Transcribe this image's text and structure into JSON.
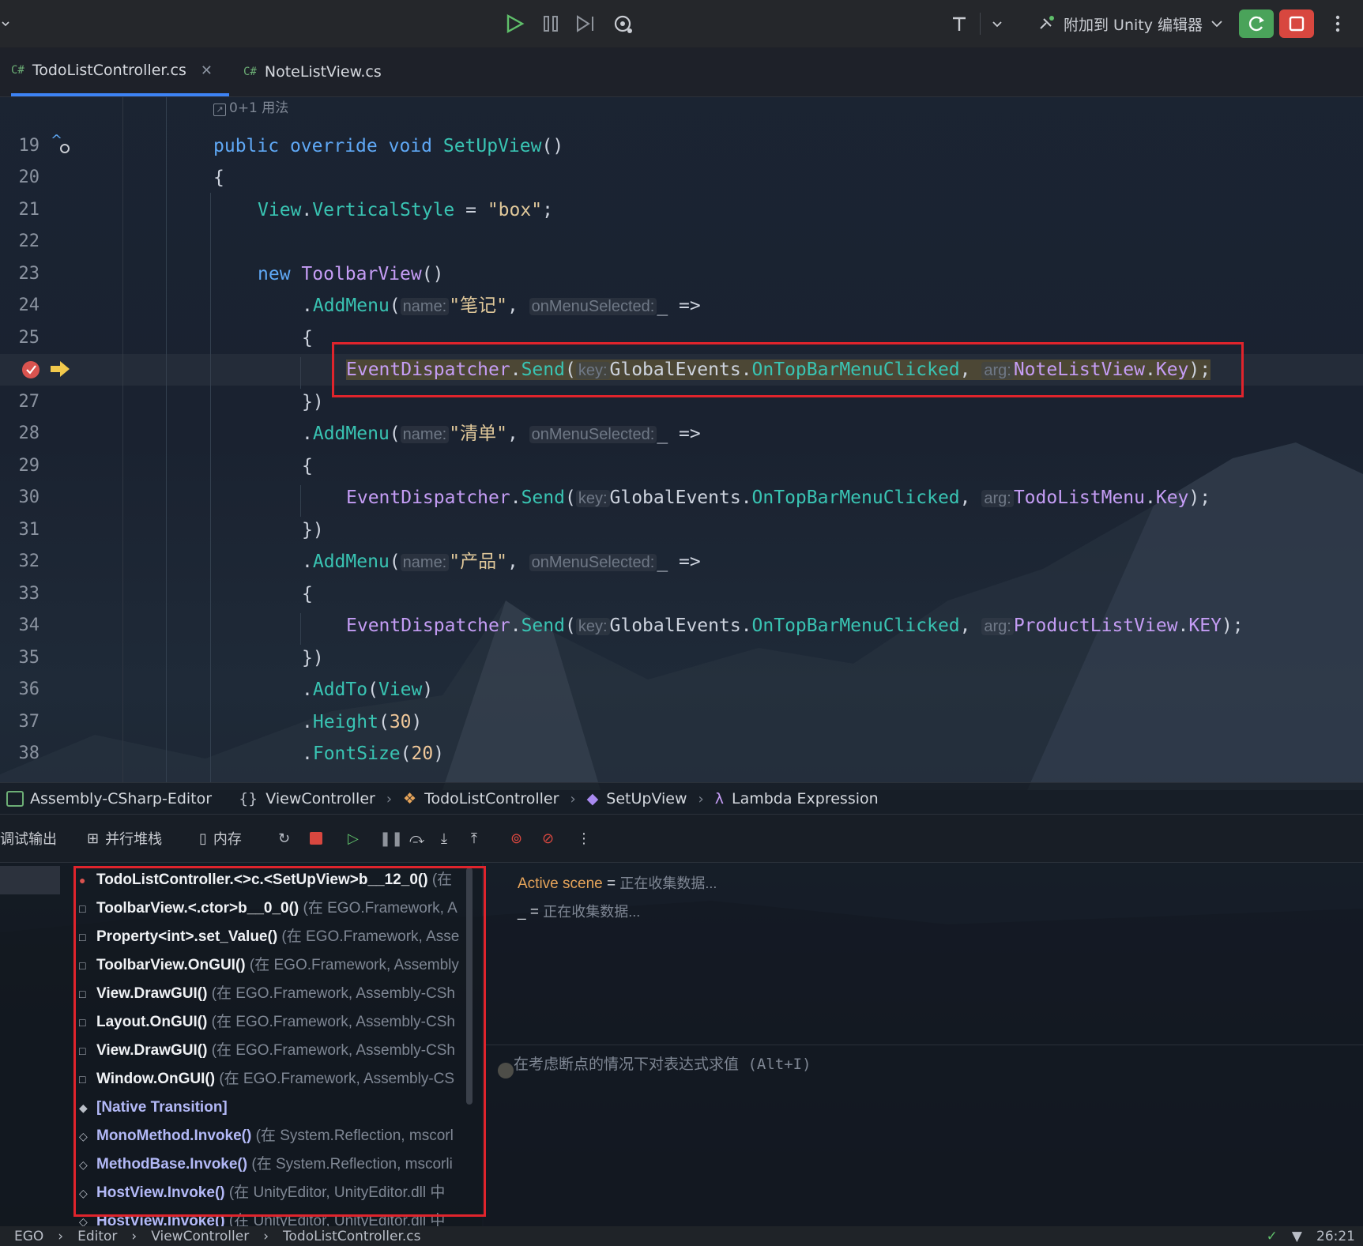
{
  "toolbar": {
    "attach_label": "附加到 Unity 编辑器"
  },
  "tabs": [
    {
      "lang": "C#",
      "label": "TodoListController.cs",
      "active": true
    },
    {
      "lang": "C#",
      "label": "NoteListView.cs",
      "active": false
    }
  ],
  "editor": {
    "usage_hint": "0+1 用法",
    "lines": [
      {
        "n": "19",
        "text": "public override void SetUpView()"
      },
      {
        "n": "20",
        "text": "{"
      },
      {
        "n": "21",
        "text": "View.VerticalStyle = \"box\";"
      },
      {
        "n": "22",
        "text": ""
      },
      {
        "n": "23",
        "text": "new ToolbarView()"
      },
      {
        "n": "24",
        "text": ".AddMenu(name: \"笔记\", onMenuSelected: _ =>"
      },
      {
        "n": "25",
        "text": "{"
      },
      {
        "n": "",
        "text": "EventDispatcher.Send(key: GlobalEvents.OnTopBarMenuClicked, arg: NoteListView.Key);"
      },
      {
        "n": "27",
        "text": "})"
      },
      {
        "n": "28",
        "text": ".AddMenu(name: \"清单\", onMenuSelected: _ =>"
      },
      {
        "n": "29",
        "text": "{"
      },
      {
        "n": "30",
        "text": "EventDispatcher.Send(key: GlobalEvents.OnTopBarMenuClicked, arg: TodoListMenu.Key);"
      },
      {
        "n": "31",
        "text": "})"
      },
      {
        "n": "32",
        "text": ".AddMenu(name: \"产品\", onMenuSelected: _ =>"
      },
      {
        "n": "33",
        "text": "{"
      },
      {
        "n": "34",
        "text": "EventDispatcher.Send(key: GlobalEvents.OnTopBarMenuClicked, arg: ProductListView.KEY);"
      },
      {
        "n": "35",
        "text": "})"
      },
      {
        "n": "36",
        "text": ".AddTo(View)"
      },
      {
        "n": "37",
        "text": ".Height(30)"
      },
      {
        "n": "38",
        "text": ".FontSize(20)"
      }
    ],
    "hints": {
      "name": "name:",
      "onMenuSelected": "onMenuSelected:",
      "key": "key:",
      "arg": "arg:"
    },
    "menu_names": [
      "\"笔记\"",
      "\"清单\"",
      "\"产品\""
    ]
  },
  "breadcrumb": [
    "Assembly-CSharp-Editor",
    "ViewController",
    "TodoListController",
    "SetUpView",
    "Lambda Expression"
  ],
  "debug_toolbar": {
    "tab_output": "调试输出",
    "tab_parallel": "并行堆栈",
    "tab_memory": "内存"
  },
  "frames": [
    {
      "marker": "●",
      "name": "TodoListController.<>c.<SetUpView>b__12_0()",
      "loc": " (在",
      "native": false
    },
    {
      "marker": "□",
      "name": "ToolbarView.<.ctor>b__0_0()",
      "loc": " (在 EGO.Framework, A",
      "native": false
    },
    {
      "marker": "□",
      "name": "Property<int>.set_Value()",
      "loc": " (在 EGO.Framework, Asse",
      "native": false
    },
    {
      "marker": "□",
      "name": "ToolbarView.OnGUI()",
      "loc": " (在 EGO.Framework, Assembly",
      "native": false
    },
    {
      "marker": "□",
      "name": "View.DrawGUI()",
      "loc": " (在 EGO.Framework, Assembly-CSh",
      "native": false
    },
    {
      "marker": "□",
      "name": "Layout.OnGUI()",
      "loc": " (在 EGO.Framework, Assembly-CSh",
      "native": false
    },
    {
      "marker": "□",
      "name": "View.DrawGUI()",
      "loc": " (在 EGO.Framework, Assembly-CSh",
      "native": false
    },
    {
      "marker": "□",
      "name": "Window.OnGUI()",
      "loc": " (在 EGO.Framework, Assembly-CS",
      "native": false
    },
    {
      "marker": "◆",
      "name": "[Native Transition]",
      "loc": "",
      "native": true
    },
    {
      "marker": "◇",
      "name": "MonoMethod.Invoke()",
      "loc": " (在 System.Reflection, mscorl",
      "native": true
    },
    {
      "marker": "◇",
      "name": "MethodBase.Invoke()",
      "loc": " (在 System.Reflection, mscorli",
      "native": true
    },
    {
      "marker": "◇",
      "name": "HostView.Invoke()",
      "loc": " (在 UnityEditor, UnityEditor.dll 中",
      "native": true
    },
    {
      "marker": "◇",
      "name": "HostView.Invoke()",
      "loc": " (在 UnityEditor, UnityEditor.dll 中",
      "native": true
    }
  ],
  "variables": [
    {
      "name": "Active scene",
      "eq": " = ",
      "value": "正在收集数据..."
    },
    {
      "name": "_",
      "eq": " = ",
      "value": "正在收集数据..."
    }
  ],
  "evaluate_placeholder": "在考虑断点的情况下对表达式求值 (Alt+I)",
  "status_bar": [
    "EGO",
    "Editor",
    "ViewController",
    "TodoListController.cs"
  ],
  "clock": "26:21"
}
